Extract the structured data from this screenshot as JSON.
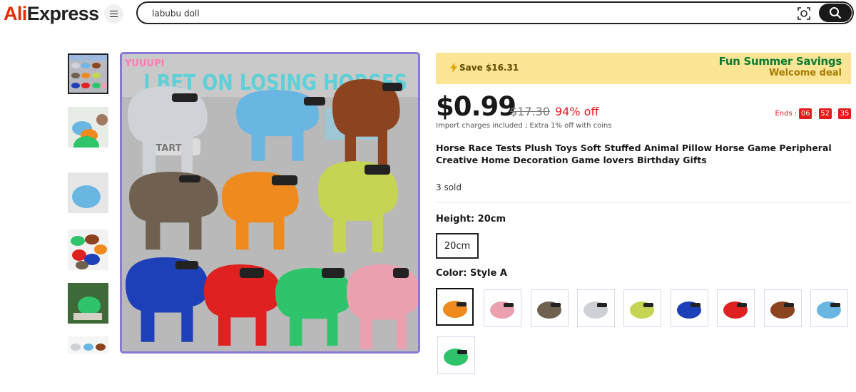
{
  "header": {
    "logo_ali": "Ali",
    "logo_express": "Express",
    "search_value": "labubu doll"
  },
  "gallery": {
    "main_image_text": "I BET ON LOSING HORSES",
    "main_image_small_text": "YUUUPI",
    "main_image_button_text": "START"
  },
  "banner": {
    "save": "Save $16.31",
    "fun": "Fun Summer Savings",
    "welcome": "Welcome deal"
  },
  "price": {
    "current": "$0.99",
    "original": "$17.30",
    "discount": "94% off",
    "note": "Import charges included ; Extra 1% off with coins",
    "ends_label": "Ends :",
    "hours": "06",
    "minutes": "52",
    "seconds": "35",
    "separator": ":"
  },
  "product": {
    "title": "Horse Race Tests Plush Toys Soft Stuffed Animal Pillow Horse Game Peripheral Creative Home Decoration Game lovers Birthday Gifts",
    "sold": "3 sold"
  },
  "options": {
    "height_label": "Height: 20cm",
    "height_value": "20cm",
    "color_label": "Color: Style A"
  },
  "swatch_colors": [
    "#ee8a1e",
    "#eba0b0",
    "#6f6050",
    "#cdd0d4",
    "#c6d454",
    "#1d3fb8",
    "#e02121",
    "#8c4420",
    "#69b6e2",
    "#2fc46b"
  ],
  "icons": {
    "menu": "menu-icon",
    "camera": "image-search-icon",
    "search": "search-icon",
    "lightning": "lightning-icon"
  }
}
